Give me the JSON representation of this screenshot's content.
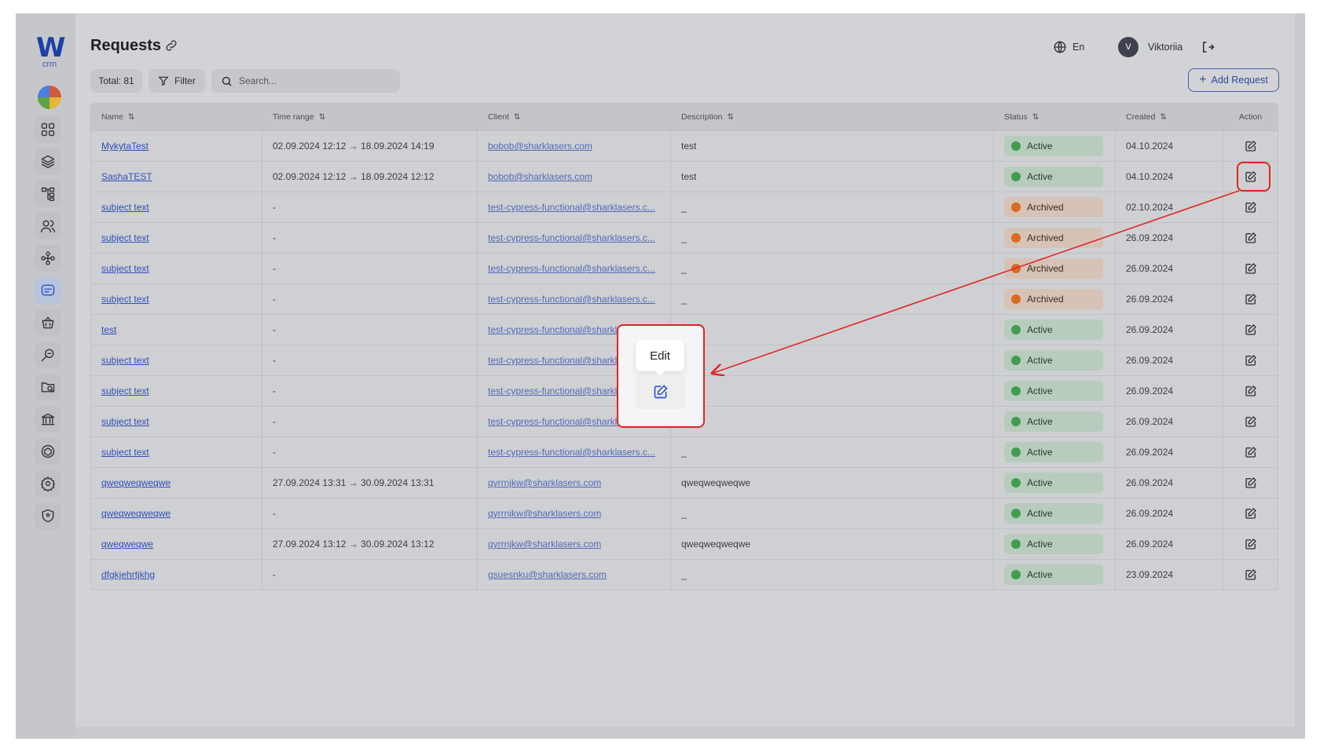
{
  "app": {
    "logo_letter": "W",
    "logo_sub": "crm"
  },
  "header": {
    "title": "Requests",
    "total": "Total: 81",
    "filter_label": "Filter",
    "search_placeholder": "Search...",
    "add_label": "Add Request",
    "language": "En",
    "user_initial": "V",
    "user_name": "Viktoriia"
  },
  "sidebar": {
    "items": [
      {
        "icon": "dashboard-grid-icon"
      },
      {
        "icon": "layers-icon"
      },
      {
        "icon": "hierarchy-icon"
      },
      {
        "icon": "users-icon"
      },
      {
        "icon": "org-structure-icon"
      },
      {
        "icon": "requests-icon",
        "active": true
      },
      {
        "icon": "basket-icon"
      },
      {
        "icon": "key-search-icon"
      },
      {
        "icon": "folder-search-icon"
      },
      {
        "icon": "bank-icon"
      },
      {
        "icon": "cube-icon"
      },
      {
        "icon": "settings-icon"
      },
      {
        "icon": "shield-icon"
      }
    ]
  },
  "table": {
    "columns": [
      "Name",
      "Time range",
      "Client",
      "Description",
      "Status",
      "Created",
      "Action"
    ],
    "rows": [
      {
        "name": "MykytaTest",
        "time_range": "02.09.2024 12:12 → 18.09.2024 14:19",
        "client": "bobob@sharklasers.com",
        "description": "test",
        "status": "Active",
        "created": "04.10.2024"
      },
      {
        "name": "SashaTEST",
        "time_range": "02.09.2024 12:12 → 18.09.2024 12:12",
        "client": "bobob@sharklasers.com",
        "description": "test",
        "status": "Active",
        "created": "04.10.2024"
      },
      {
        "name": "subject text",
        "time_range": "-",
        "client": "test-cypress-functional@sharklasers.c...",
        "description": "_",
        "status": "Archived",
        "created": "02.10.2024"
      },
      {
        "name": "subject text",
        "time_range": "-",
        "client": "test-cypress-functional@sharklasers.c...",
        "description": "_",
        "status": "Archived",
        "created": "26.09.2024"
      },
      {
        "name": "subject text",
        "time_range": "-",
        "client": "test-cypress-functional@sharklasers.c...",
        "description": "_",
        "status": "Archived",
        "created": "26.09.2024"
      },
      {
        "name": "subject text",
        "time_range": "-",
        "client": "test-cypress-functional@sharklasers.c...",
        "description": "_",
        "status": "Archived",
        "created": "26.09.2024"
      },
      {
        "name": "test",
        "time_range": "-",
        "client": "test-cypress-functional@sharklasers.c...",
        "description": "",
        "status": "Active",
        "created": "26.09.2024"
      },
      {
        "name": "subject text",
        "time_range": "-",
        "client": "test-cypress-functional@sharklasers.c...",
        "description": "",
        "status": "Active",
        "created": "26.09.2024"
      },
      {
        "name": "subject text",
        "time_range": "-",
        "client": "test-cypress-functional@sharklasers.c...",
        "description": "",
        "status": "Active",
        "created": "26.09.2024"
      },
      {
        "name": "subject text",
        "time_range": "-",
        "client": "test-cypress-functional@sharklasers.c...",
        "description": "",
        "status": "Active",
        "created": "26.09.2024"
      },
      {
        "name": "subject text",
        "time_range": "-",
        "client": "test-cypress-functional@sharklasers.c...",
        "description": "_",
        "status": "Active",
        "created": "26.09.2024"
      },
      {
        "name": "qweqweqweqwe",
        "time_range": "27.09.2024 13:31 → 30.09.2024 13:31",
        "client": "qyrrnjkw@sharklasers.com",
        "description": "qweqweqweqwe",
        "status": "Active",
        "created": "26.09.2024"
      },
      {
        "name": "qweqweqweqwe",
        "time_range": "-",
        "client": "qyrrnjkw@sharklasers.com",
        "description": "_",
        "status": "Active",
        "created": "26.09.2024"
      },
      {
        "name": "qweqweqwe",
        "time_range": "27.09.2024 13:12 → 30.09.2024 13:12",
        "client": "qyrrnjkw@sharklasers.com",
        "description": "qweqweqweqwe",
        "status": "Active",
        "created": "26.09.2024"
      },
      {
        "name": "dfgkjehrtjkhg",
        "time_range": "-",
        "client": "gsuesnku@sharklasers.com",
        "description": "_",
        "status": "Active",
        "created": "23.09.2024"
      }
    ]
  },
  "tooltip": {
    "label": "Edit"
  },
  "annotation_color": "#e02424"
}
